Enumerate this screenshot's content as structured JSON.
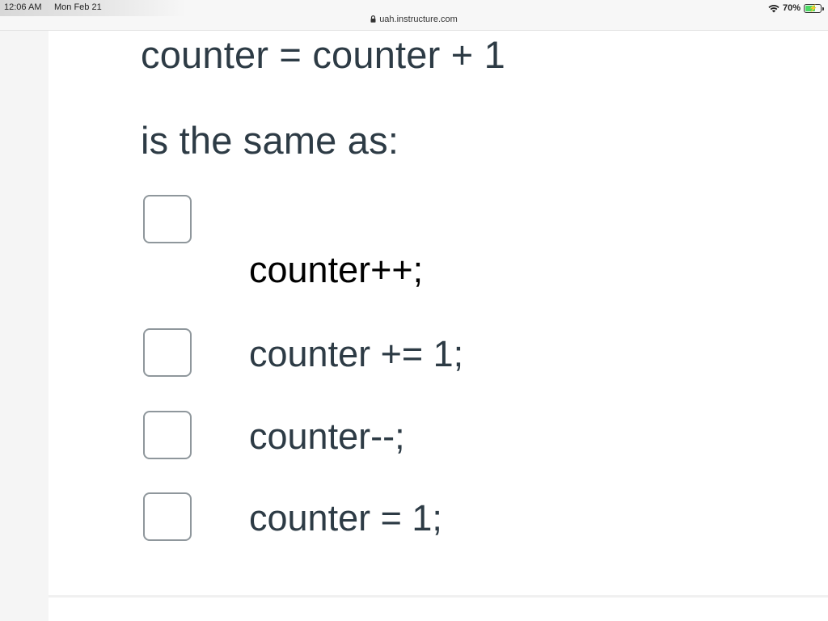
{
  "status_bar": {
    "time": "12:06 AM",
    "date": "Mon Feb 21",
    "battery": "70%",
    "battery_level": 0.7,
    "url": "uah.instructure.com"
  },
  "question": {
    "line1": "counter = counter + 1",
    "line2": "is the same as:"
  },
  "answers": [
    {
      "label": "counter++;",
      "checked": false
    },
    {
      "label": "counter += 1;",
      "checked": false
    },
    {
      "label": "counter--;",
      "checked": false
    },
    {
      "label": "counter = 1;",
      "checked": false
    }
  ],
  "icons": {
    "wifi": "wifi-icon",
    "battery": "battery-icon",
    "lock": "lock-icon",
    "checkbox": "checkbox-icon"
  }
}
